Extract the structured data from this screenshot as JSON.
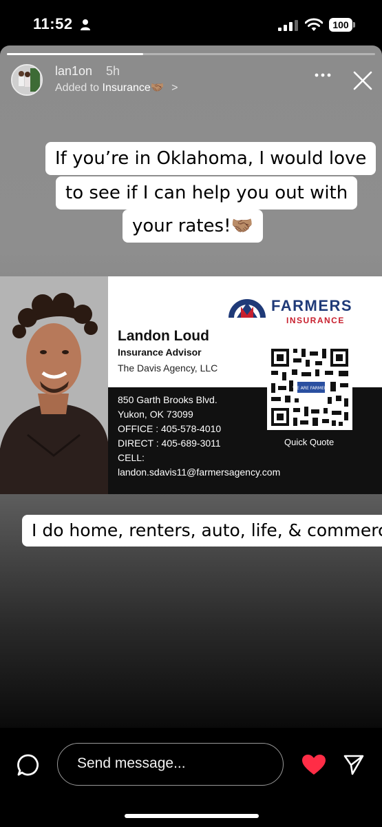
{
  "status_bar": {
    "time": "11:52",
    "battery": "100"
  },
  "story": {
    "progress": 0.37,
    "username": "lan1on",
    "time_ago": "5h",
    "added_to_prefix": "Added to",
    "highlight_name": "Insurance",
    "highlight_emoji": "🤝🏽",
    "chevron": ">"
  },
  "captions": {
    "top_lines": [
      "If you’re in Oklahoma, I would love",
      "to see if I can help you out with",
      "your rates!🤝🏽"
    ],
    "bottom": "I do home, renters, auto, life, & commercial!"
  },
  "card": {
    "logo_word": "FARMERS",
    "logo_sub": "INSURANCE",
    "name": "Landon Loud",
    "title": "Insurance Advisor",
    "agency": "The Davis Agency, LLC",
    "address_line1": "850 Garth Brooks Blvd.",
    "address_line2": "Yukon, OK 73099",
    "office": "OFFICE : 405-578-4010",
    "direct": "DIRECT : 405-689-3011",
    "cell": "CELL:",
    "email": "landon.sdavis11@farmersagency.com",
    "qr_label": "Quick Quote",
    "qr_badge": "WE ARE FARMERS"
  },
  "bottom_bar": {
    "send_placeholder": "Send message..."
  },
  "colors": {
    "farmers_blue": "#1f3a78",
    "farmers_red": "#c8202e",
    "heart": "#ff2d46"
  },
  "icons": [
    "person-icon",
    "signal-icon",
    "wifi-icon",
    "battery-icon",
    "more-icon",
    "close-icon",
    "chat-icon",
    "heart-icon",
    "send-icon"
  ]
}
